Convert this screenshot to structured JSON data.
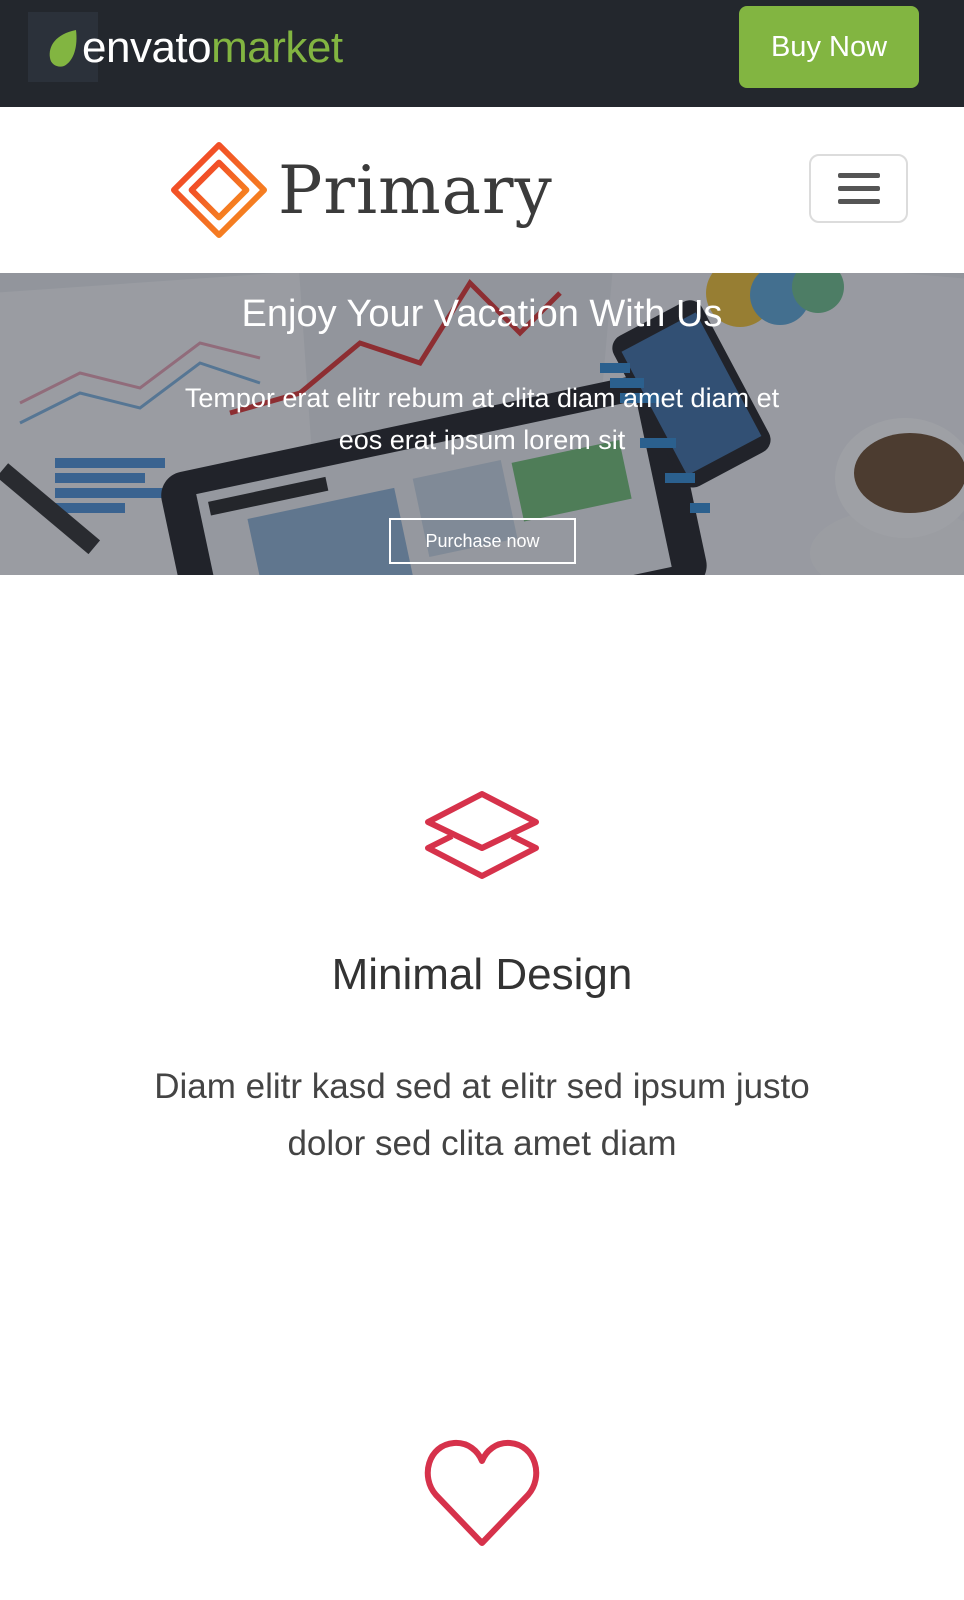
{
  "envato": {
    "logo_word_1": "envato",
    "logo_word_2": "market",
    "buy_label": "Buy Now"
  },
  "nav": {
    "brand_name": "Primary",
    "brand_color": "#f05a28"
  },
  "hero": {
    "title": "Enjoy Your Vacation With Us",
    "subtitle": "Tempor erat elitr rebum at clita diam amet diam et eos erat ipsum lorem sit",
    "button_label": "Purchase now"
  },
  "features": [
    {
      "icon": "layers-icon",
      "title": "Minimal Design",
      "text": "Diam elitr kasd sed at elitr sed ipsum justo dolor sed clita amet diam"
    },
    {
      "icon": "heart-icon"
    }
  ],
  "colors": {
    "accent_red": "#d6324b",
    "envato_green": "#82b541",
    "topbar_bg": "#23272d"
  }
}
